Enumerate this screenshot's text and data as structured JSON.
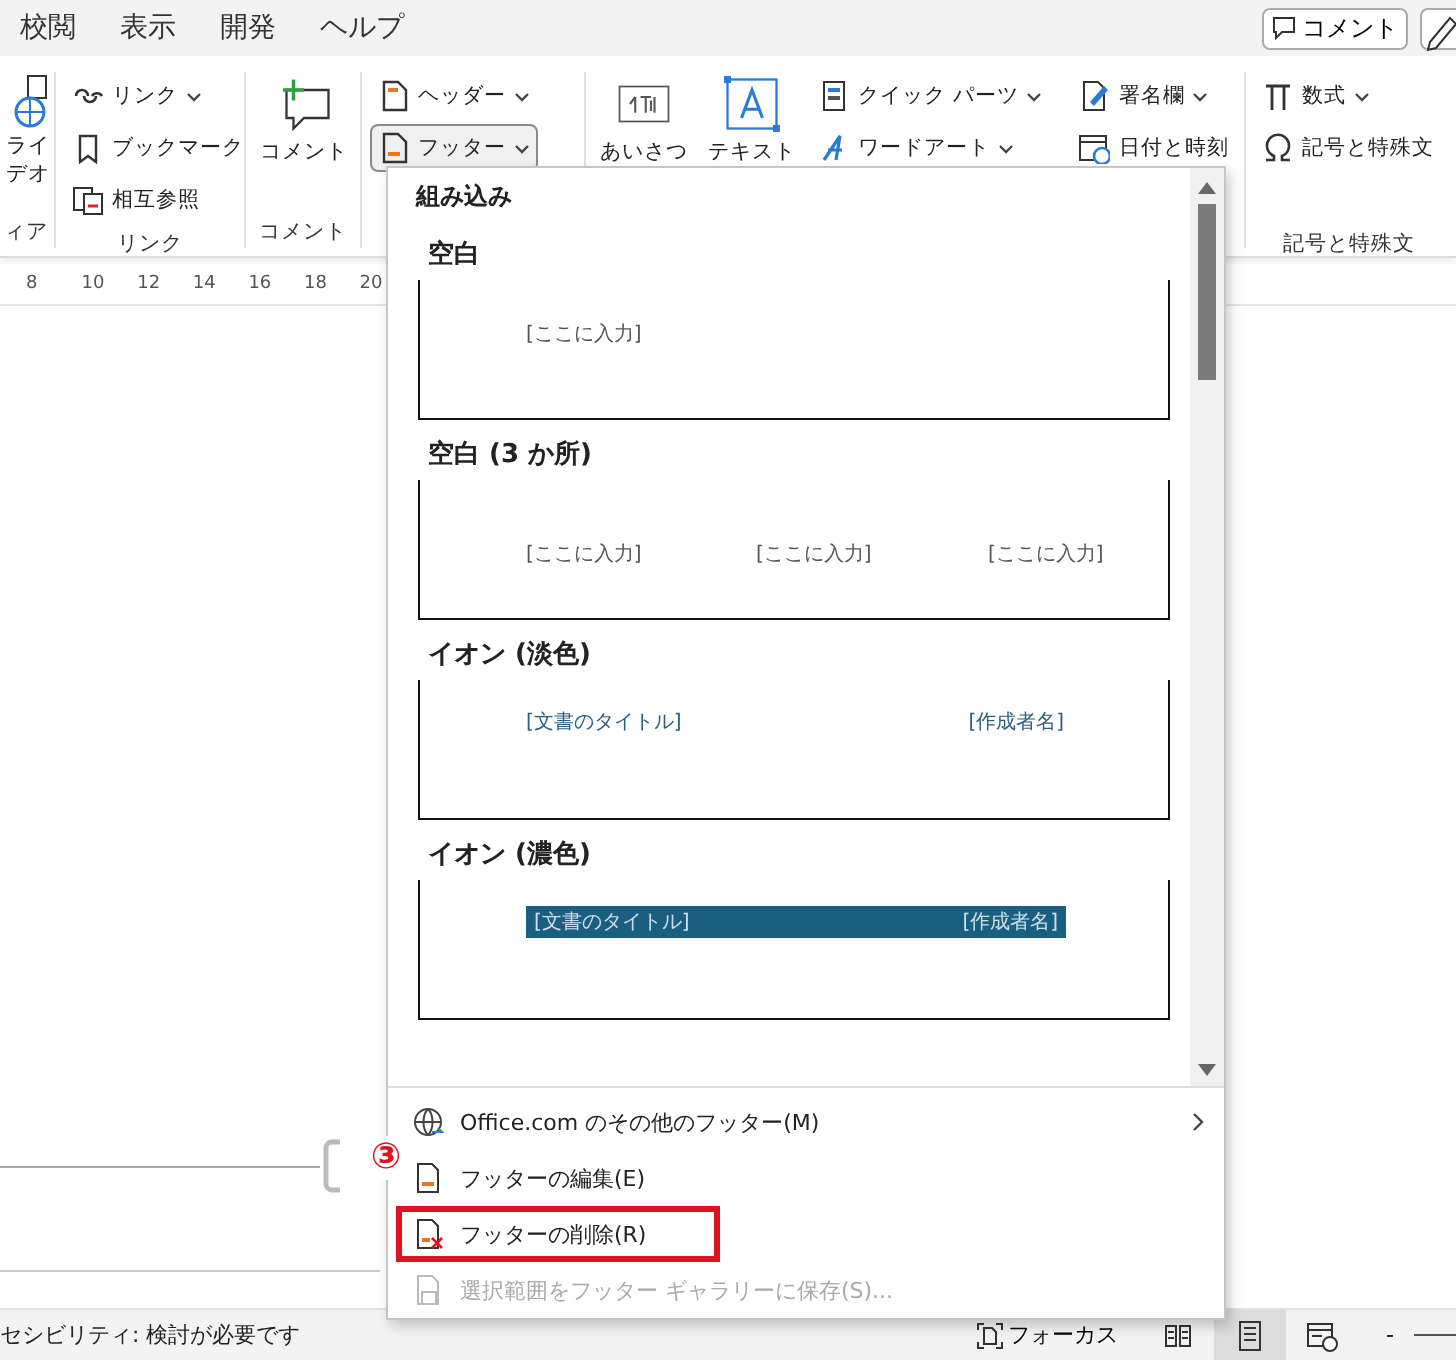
{
  "tabs": [
    {
      "label": "校閲"
    },
    {
      "label": "表示"
    },
    {
      "label": "開発"
    },
    {
      "label": "ヘルプ"
    }
  ],
  "title_buttons": [
    {
      "kind": "comment",
      "label": "コメント"
    },
    {
      "kind": "edit"
    }
  ],
  "ribbon": {
    "groups": [
      {
        "label": "ィア",
        "items": [
          {
            "kind": "large",
            "label": "ライデオ"
          }
        ]
      },
      {
        "label": "リンク",
        "items": [
          {
            "kind": "small",
            "label": "リンク",
            "dropdown": true
          },
          {
            "kind": "small",
            "label": "ブックマーク",
            "dropdown": false
          },
          {
            "kind": "small",
            "label": "相互参照",
            "dropdown": false
          }
        ]
      },
      {
        "label": "コメント",
        "items": [
          {
            "kind": "large",
            "label": "コメント"
          }
        ]
      },
      {
        "items": [
          {
            "kind": "small",
            "label": "ヘッダー",
            "dropdown": true,
            "pressed": false
          },
          {
            "kind": "small",
            "label": "フッター",
            "dropdown": true,
            "pressed": true
          }
        ]
      },
      {
        "items": [
          {
            "kind": "large",
            "label": "あいさつ"
          },
          {
            "kind": "large",
            "label": "テキスト"
          },
          {
            "kind": "small",
            "label": "クイック パーツ",
            "dropdown": true
          },
          {
            "kind": "small",
            "label": "ワードアート",
            "dropdown": true
          },
          {
            "kind": "blank"
          },
          {
            "kind": "small",
            "label": "署名欄",
            "dropdown": true
          },
          {
            "kind": "small",
            "label": "日付と時刻",
            "dropdown": false
          }
        ]
      },
      {
        "label": "記号と特殊文",
        "items": [
          {
            "kind": "small",
            "label": "数式",
            "dropdown": true
          },
          {
            "kind": "small",
            "label": "記号と特殊文",
            "dropdown": false
          }
        ]
      }
    ]
  },
  "ruler": [
    "8",
    "10",
    "12",
    "14",
    "16",
    "18",
    "20"
  ],
  "menu": {
    "section": "組み込み",
    "gallery": [
      {
        "kind": "blank",
        "title": "空白",
        "texts": [
          "[ここに入力]"
        ]
      },
      {
        "kind": "blank3",
        "title": "空白 (3 か所)",
        "texts": [
          "[ここに入力]",
          "[ここに入力]",
          "[ここに入力]"
        ]
      },
      {
        "kind": "ion-light",
        "title": "イオン (淡色)",
        "texts": [
          "[文書のタイトル]",
          "[作成者名]"
        ]
      },
      {
        "kind": "ion-dark",
        "title": "イオン (濃色)",
        "texts": [
          "[文書のタイトル]",
          "[作成者名]"
        ]
      }
    ],
    "actions": [
      {
        "label": "Office.com のその他のフッター(M)",
        "submenu": true,
        "disabled": false,
        "highlighted": false
      },
      {
        "label": "フッターの編集(E)",
        "submenu": false,
        "disabled": false,
        "highlighted": false
      },
      {
        "label": "フッターの削除(R)",
        "submenu": false,
        "disabled": false,
        "highlighted": true
      },
      {
        "label": "選択範囲をフッター ギャラリーに保存(S)...",
        "submenu": false,
        "disabled": true,
        "highlighted": false
      }
    ],
    "annotation": "③"
  },
  "status_bar": {
    "text": "セシビリティ: 検討が必要です",
    "focus": "フォーカス",
    "views": [
      {
        "selected": false
      },
      {
        "selected": true
      },
      {
        "selected": false
      }
    ],
    "zoom_out": "-"
  }
}
